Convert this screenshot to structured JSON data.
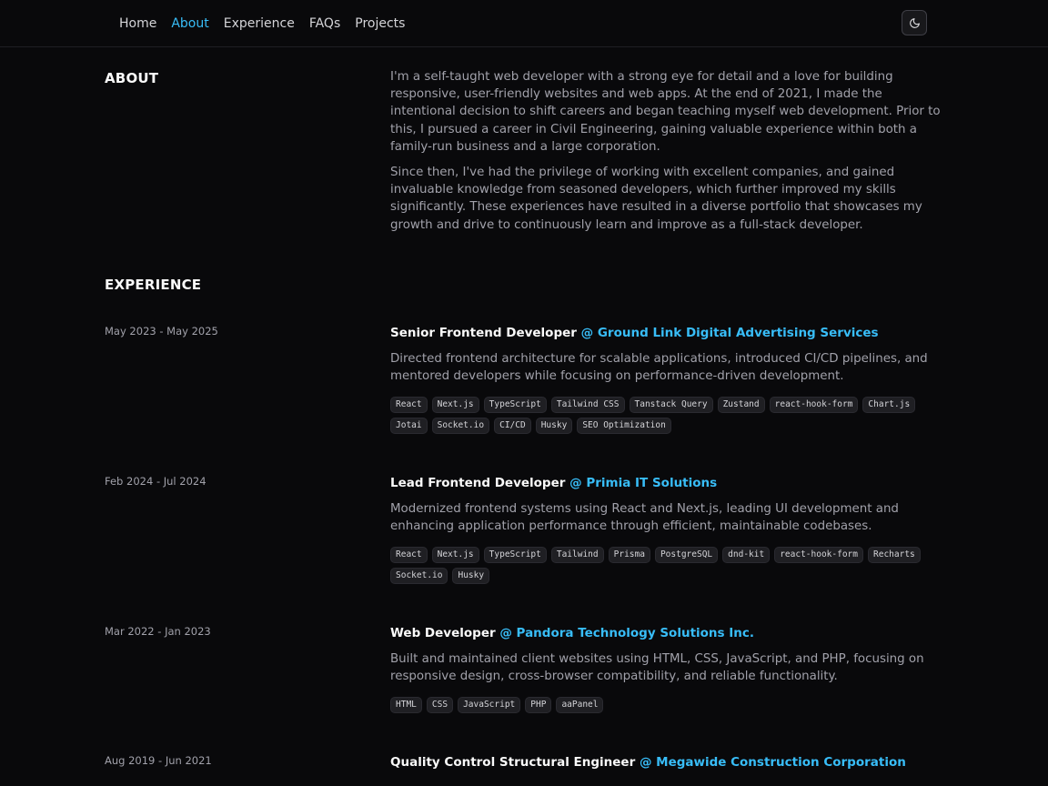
{
  "nav": {
    "links": [
      "Home",
      "About",
      "Experience",
      "FAQs",
      "Projects"
    ],
    "active_index": 1,
    "theme_toggle_icon": "moon-icon"
  },
  "about": {
    "title": "ABOUT",
    "paragraphs": [
      "I'm a self-taught web developer with a strong eye for detail and a love for building responsive, user-friendly websites and web apps. At the end of 2021, I made the intentional decision to shift careers and began teaching myself web development. Prior to this, I pursued a career in Civil Engineering, gaining valuable experience within both a family-run business and a large corporation.",
      "Since then, I've had the privilege of working with excellent companies, and gained invaluable knowledge from seasoned developers, which further improved my skills significantly. These experiences have resulted in a diverse portfolio that showcases my growth and drive to continuously learn and improve as a full-stack developer."
    ]
  },
  "experience": {
    "title": "EXPERIENCE",
    "items": [
      {
        "date": "May 2023 - May 2025",
        "role": "Senior Frontend Developer",
        "company": "@ Ground Link Digital Advertising Services",
        "description": "Directed frontend architecture for scalable applications, introduced CI/CD pipelines, and mentored developers while focusing on performance-driven development.",
        "tags": [
          "React",
          "Next.js",
          "TypeScript",
          "Tailwind CSS",
          "Tanstack Query",
          "Zustand",
          "react-hook-form",
          "Chart.js",
          "Jotai",
          "Socket.io",
          "CI/CD",
          "Husky",
          "SEO Optimization"
        ]
      },
      {
        "date": "Feb 2024 - Jul 2024",
        "role": "Lead Frontend Developer",
        "company": "@ Primia IT Solutions",
        "description": "Modernized frontend systems using React and Next.js, leading UI development and enhancing application performance through efficient, maintainable codebases.",
        "tags": [
          "React",
          "Next.js",
          "TypeScript",
          "Tailwind",
          "Prisma",
          "PostgreSQL",
          "dnd-kit",
          "react-hook-form",
          "Recharts",
          "Socket.io",
          "Husky"
        ]
      },
      {
        "date": "Mar 2022 - Jan 2023",
        "role": "Web Developer",
        "company": "@ Pandora Technology Solutions Inc.",
        "description": "Built and maintained client websites using HTML, CSS, JavaScript, and PHP, focusing on responsive design, cross-browser compatibility, and reliable functionality.",
        "tags": [
          "HTML",
          "CSS",
          "JavaScript",
          "PHP",
          "aaPanel"
        ]
      },
      {
        "date": "Aug 2019 - Jun 2021",
        "role": "Quality Control Structural Engineer",
        "company": "@ Megawide Construction Corporation",
        "description": "",
        "tags": []
      }
    ]
  },
  "colors": {
    "background": "#09090b",
    "accent": "#38bdf8",
    "heading": "#fafafa",
    "body_text": "#a1a1aa"
  }
}
